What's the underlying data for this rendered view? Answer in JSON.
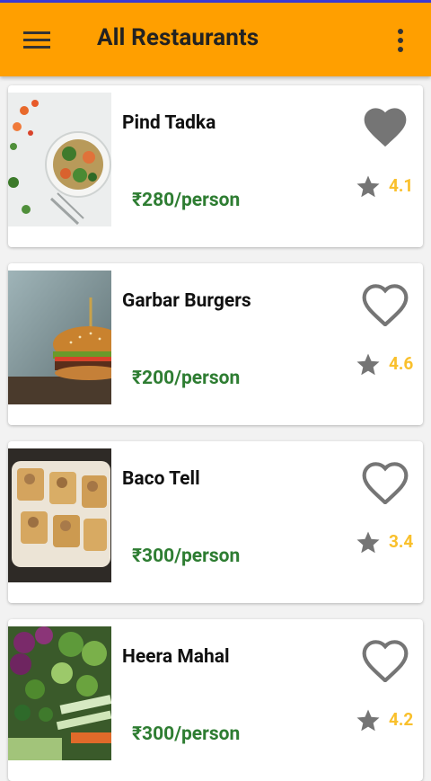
{
  "colors": {
    "appbar": "#ff9f00",
    "price": "#2e7d32",
    "rating": "#f9c02c",
    "icon_grey": "#757575"
  },
  "appbar": {
    "title": "All Restaurants",
    "menu_icon": "hamburger-menu-icon",
    "more_icon": "overflow-menu-icon"
  },
  "restaurants": [
    {
      "name": "Pind Tadka",
      "price": "₹280/person",
      "rating": "4.1",
      "favorite": true,
      "image": "salad-bowl-photo"
    },
    {
      "name": "Garbar Burgers",
      "price": "₹200/person",
      "rating": "4.6",
      "favorite": false,
      "image": "burger-photo"
    },
    {
      "name": "Baco Tell",
      "price": "₹300/person",
      "rating": "3.4",
      "favorite": false,
      "image": "taco-cups-photo"
    },
    {
      "name": "Heera Mahal",
      "price": "₹300/person",
      "rating": "4.2",
      "favorite": false,
      "image": "vegetables-photo"
    }
  ]
}
